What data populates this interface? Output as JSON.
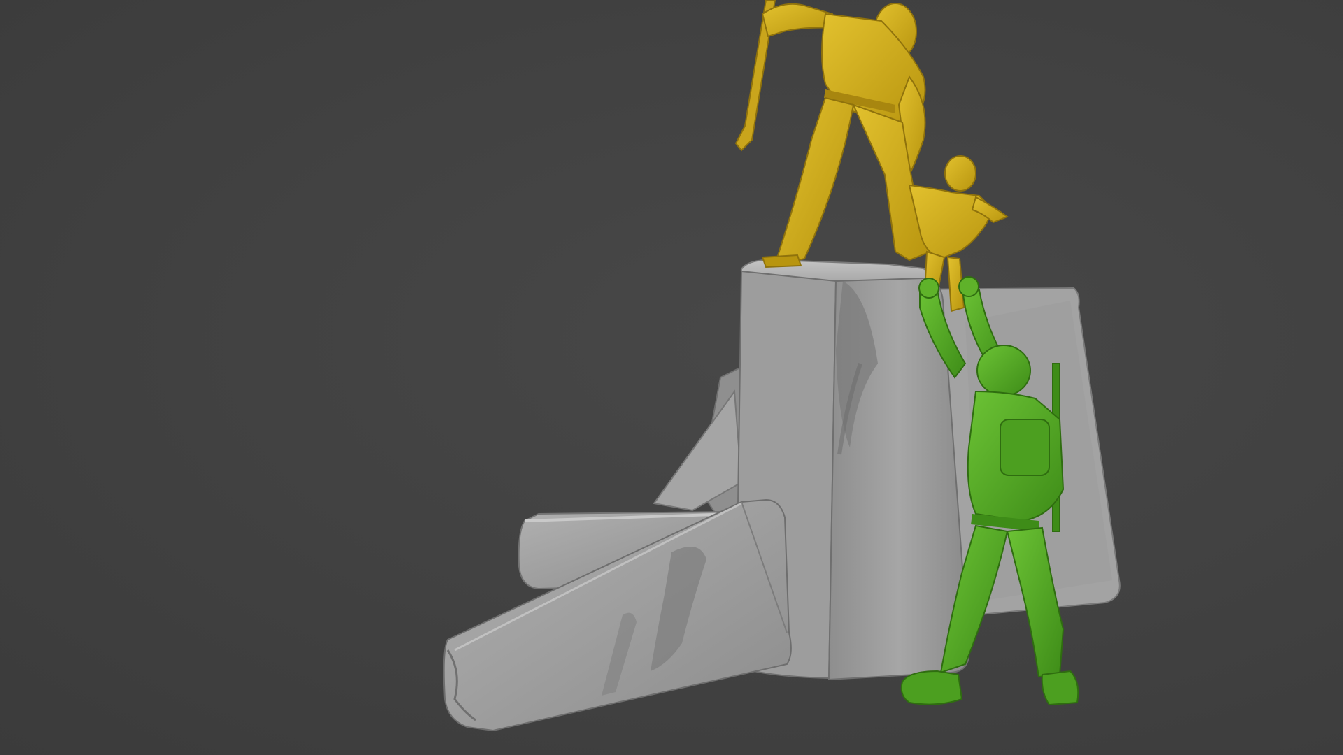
{
  "viewport": {
    "background": "#414141"
  },
  "scene": {
    "subject": "diorama-render",
    "colors": {
      "rock_light": "#b4b4b4",
      "rock_mid": "#9a9a9a",
      "rock_dark": "#7b7b7b",
      "rock_shadow": "#6a6a6a",
      "adult_figure": "#d6b21f",
      "adult_figure_shade": "#a8860f",
      "child_figure": "#dcb929",
      "soldier_figure": "#5fb22a",
      "soldier_figure_shade": "#3f8a17"
    }
  }
}
